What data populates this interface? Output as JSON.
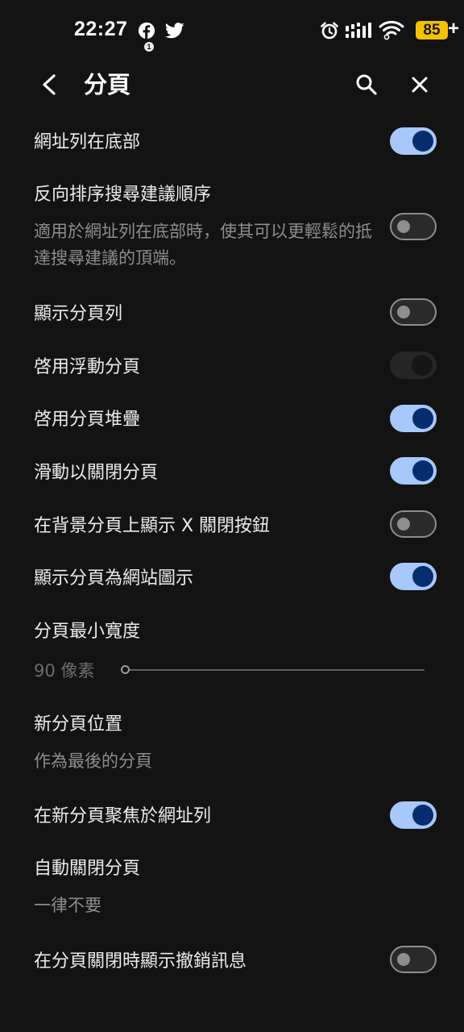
{
  "status_bar": {
    "time": "22:27",
    "notification_count": "1",
    "battery": "85",
    "battery_suffix": "+",
    "icons": [
      "facebook-icon",
      "twitter-icon",
      "alarm-icon",
      "signal-icon",
      "wifi-icon",
      "battery-icon"
    ]
  },
  "app_bar": {
    "title": "分頁",
    "icons": [
      "back-arrow-icon",
      "search-icon",
      "close-icon"
    ]
  },
  "settings": {
    "address_bar_bottom": {
      "title": "網址列在底部",
      "enabled": true
    },
    "reverse_suggestions": {
      "title": "反向排序搜尋建議順序",
      "subtitle": "適用於網址列在底部時，使其可以更輕鬆的抵達搜尋建議的頂端。",
      "enabled": false
    },
    "show_tab_bar": {
      "title": "顯示分頁列",
      "enabled": false
    },
    "floating_tabs": {
      "title": "啓用浮動分頁",
      "enabled": false,
      "state": "disabled"
    },
    "tab_stacking": {
      "title": "啓用分頁堆疊",
      "enabled": true
    },
    "swipe_close": {
      "title": "滑動以關閉分頁",
      "enabled": true
    },
    "background_close_button": {
      "title": "在背景分頁上顯示 X 關閉按鈕",
      "enabled": false
    },
    "tab_favicon": {
      "title": "顯示分頁為網站圖示",
      "enabled": true
    },
    "min_tab_width": {
      "title": "分頁最小寬度",
      "value_label": "90 像素",
      "slider_value": 90
    },
    "new_tab_position": {
      "title": "新分頁位置",
      "value": "作為最後的分頁"
    },
    "focus_address_bar": {
      "title": "在新分頁聚焦於網址列",
      "enabled": true
    },
    "auto_close_tabs": {
      "title": "自動關閉分頁",
      "value": "一律不要"
    },
    "undo_message": {
      "title": "在分頁關閉時顯示撤銷訊息",
      "enabled": false
    }
  },
  "colors": {
    "background": "#131313",
    "switch_on_track": "#a8c7fa",
    "switch_on_knob": "#062e6f",
    "switch_off_outline": "#8e8e8e",
    "battery": "#f2c200"
  }
}
